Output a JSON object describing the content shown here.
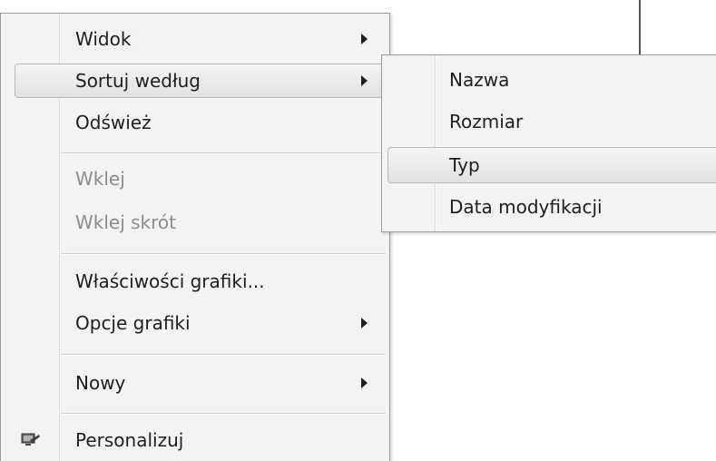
{
  "context_menu": {
    "items": [
      {
        "label": "Widok",
        "submenu": true,
        "enabled": true
      },
      {
        "label": "Sortuj według",
        "submenu": true,
        "enabled": true,
        "highlighted": true
      },
      {
        "label": "Odśwież",
        "submenu": false,
        "enabled": true
      },
      {
        "label": "Wklej",
        "submenu": false,
        "enabled": false
      },
      {
        "label": "Wklej skrót",
        "submenu": false,
        "enabled": false
      },
      {
        "label": "Właściwości grafiki...",
        "submenu": false,
        "enabled": true
      },
      {
        "label": "Opcje grafiki",
        "submenu": true,
        "enabled": true
      },
      {
        "label": "Nowy",
        "submenu": true,
        "enabled": true
      },
      {
        "label": "Personalizuj",
        "submenu": false,
        "enabled": true,
        "icon": "personalize-icon"
      }
    ]
  },
  "sort_submenu": {
    "items": [
      {
        "label": "Nazwa"
      },
      {
        "label": "Rozmiar"
      },
      {
        "label": "Typ",
        "highlighted": true
      },
      {
        "label": "Data modyfikacji"
      }
    ]
  },
  "colors": {
    "menu_background": "#f3f3f3",
    "highlight": "#e8e8e8",
    "disabled_text": "#8c8c8c"
  }
}
